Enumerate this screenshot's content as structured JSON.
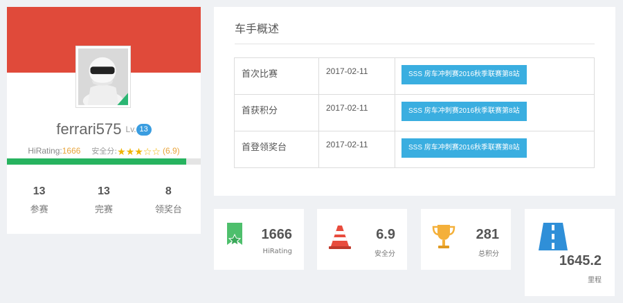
{
  "profile": {
    "username": "ferrari575",
    "level_label": "Lv.",
    "level": "13",
    "hirating_label": "HiRating:",
    "hirating_value": "1666",
    "safety_label": "安全分:",
    "safety_stars": [
      {
        "symbol": "★"
      },
      {
        "symbol": "★"
      },
      {
        "symbol": "★"
      },
      {
        "symbol": "☆"
      },
      {
        "symbol": "☆"
      }
    ],
    "safety_score": "(6.9)",
    "progress_fraction": 0.925,
    "stats": [
      {
        "value": "13",
        "label": "参赛"
      },
      {
        "value": "13",
        "label": "完赛"
      },
      {
        "value": "8",
        "label": "领奖台"
      }
    ]
  },
  "overview": {
    "title": "车手概述",
    "rows": [
      {
        "label": "首次比赛",
        "date": "2017-02-11",
        "event": "SSS 房车冲刺赛2016秋季联赛第8站"
      },
      {
        "label": "首获积分",
        "date": "2017-02-11",
        "event": "SSS 房车冲刺赛2016秋季联赛第8站"
      },
      {
        "label": "首登领奖台",
        "date": "2017-02-11",
        "event": "SSS 房车冲刺赛2016秋季联赛第8站"
      }
    ]
  },
  "metrics": [
    {
      "icon": "ribbon-badge-icon",
      "value": "1666",
      "label": "HiRating"
    },
    {
      "icon": "traffic-cone-icon",
      "value": "6.9",
      "label": "安全分"
    },
    {
      "icon": "trophy-icon",
      "value": "281",
      "label": "总积分"
    },
    {
      "icon": "road-icon",
      "value": "1645.2",
      "label": "里程"
    }
  ],
  "colors": {
    "banner": "#e04a3a",
    "accent_blue": "#3aaee0",
    "level_badge": "#3a9de0",
    "progress": "#27b35f",
    "rating_gold": "#e8a33a",
    "ribbon_green": "#4ebf6c",
    "cone_red": "#e84c3d",
    "trophy_gold": "#f4b03a",
    "road_blue": "#2f8fd8"
  }
}
